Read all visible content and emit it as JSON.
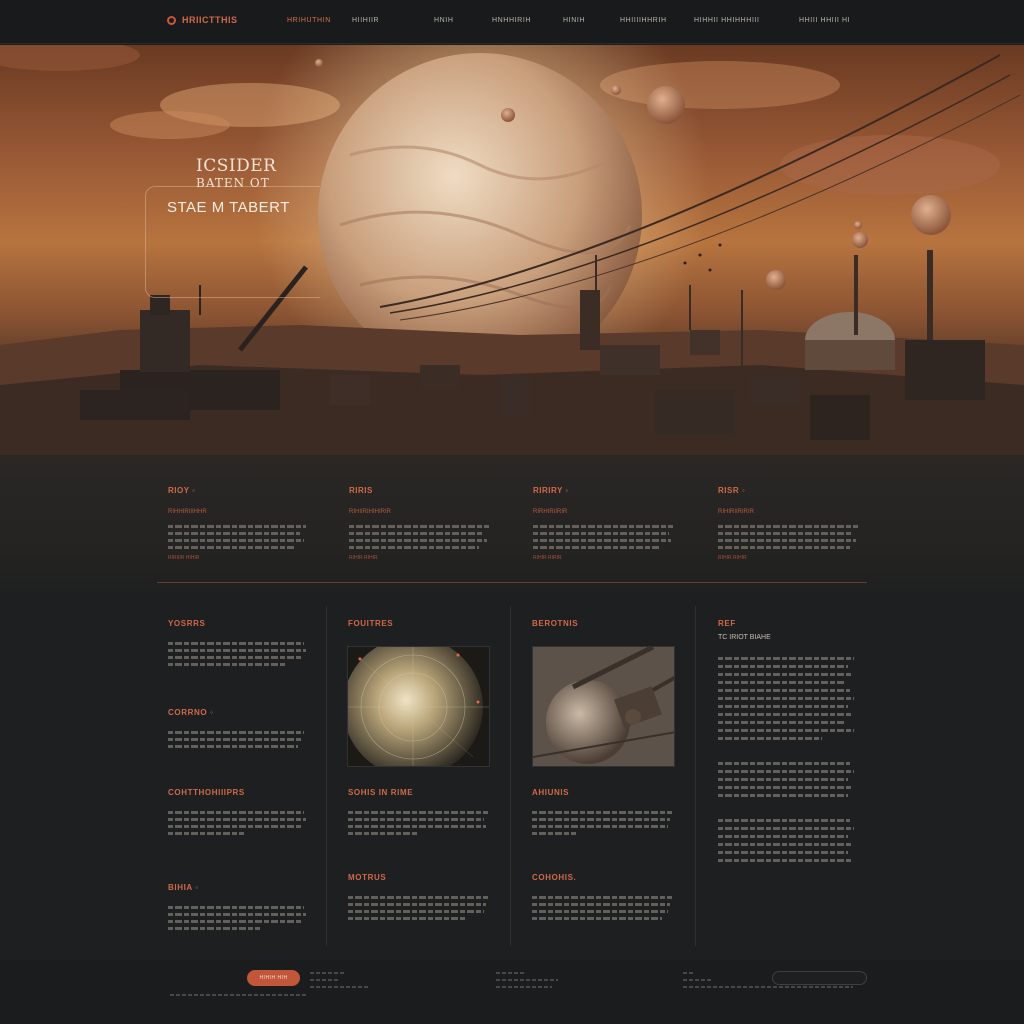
{
  "nav": {
    "logo_text": "HRIICTTHIS",
    "items": [
      "HRIHUTHIN",
      "HIIHIIR",
      "HNIH",
      "HNHHIRIH",
      "HINIH",
      "HHIIIIHHRIH",
      "HIHHII HHIHHHIII",
      "HHIII HHIII HI"
    ]
  },
  "hero": {
    "line1": "ICSIDER",
    "line2": "BATEN OT",
    "line3": "STAE M TABERT"
  },
  "features": [
    {
      "title": "RIOY ◦",
      "sub": "RIHHIRIIIHHR",
      "more": "RIRIIIR HIHIR"
    },
    {
      "title": "RIRIS",
      "sub": "RIHIIRIHIHIRIR",
      "more": "RIHIR RIHIR"
    },
    {
      "title": "RIRIRY ◦",
      "sub": "RIRHIRIIRIR",
      "more": "RIHIR RIRIR"
    },
    {
      "title": "RISR ◦",
      "sub": "RIHIRIIRIRIR",
      "more": "RIHIR RIHIR"
    }
  ],
  "sections": {
    "col1": [
      {
        "title": "YOSRRS"
      },
      {
        "title": "CORRNO ◦"
      },
      {
        "title": "COHTTHOHIIIPRS"
      },
      {
        "title": "BIHIA ◦"
      }
    ],
    "col2": [
      {
        "title": "FOUITRES"
      },
      {
        "title": "SOHIS IN RIME"
      },
      {
        "title": "MOTRUS"
      }
    ],
    "col3": [
      {
        "title": "BEROTNIS"
      },
      {
        "title": "AHIUNIS"
      },
      {
        "title": "COHOHIS."
      }
    ],
    "col4": {
      "title": "REF",
      "subtitle": "TC IRIOT BIAHE"
    }
  },
  "footer": {
    "button_label": "HIHIH HIH"
  },
  "colors": {
    "accent": "#d16948",
    "background": "#1b1d1e",
    "hero_sky": "#b7743f"
  }
}
